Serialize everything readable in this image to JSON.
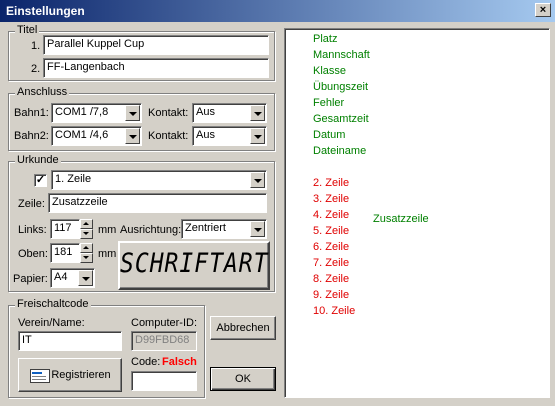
{
  "window": {
    "title": "Einstellungen",
    "close_glyph": "×"
  },
  "titel": {
    "legend": "Titel",
    "row1_label": "1.",
    "row1_value": "Parallel Kuppel Cup",
    "row2_label": "2.",
    "row2_value": "FF-Langenbach"
  },
  "anschluss": {
    "legend": "Anschluss",
    "bahn1_label": "Bahn1:",
    "bahn1_value": "COM1 /7,8",
    "kontakt1_label": "Kontakt:",
    "kontakt1_value": "Aus",
    "bahn2_label": "Bahn2:",
    "bahn2_value": "COM1 /4,6",
    "kontakt2_label": "Kontakt:",
    "kontakt2_value": "Aus"
  },
  "urkunde": {
    "legend": "Urkunde",
    "checkbox_mark": "✓",
    "zeile_select": "1. Zeile",
    "zeile_label": "Zeile:",
    "zeile_value": "Zusatzzeile",
    "links_label": "Links:",
    "links_value": "117",
    "links_unit": "mm",
    "ausrichtung_label": "Ausrichtung:",
    "ausrichtung_value": "Zentriert",
    "oben_label": "Oben:",
    "oben_value": "181",
    "oben_unit": "mm",
    "papier_label": "Papier:",
    "papier_value": "A4",
    "font_button": "SCHRIFTART"
  },
  "freischaltcode": {
    "legend": "Freischaltcode",
    "verein_label": "Verein/Name:",
    "verein_value": "IT",
    "computer_id_label": "Computer-ID:",
    "computer_id_value": "D99FBD68",
    "register_button": "Registrieren",
    "code_label": "Code:",
    "code_status": "Falsch",
    "code_value": ""
  },
  "buttons": {
    "cancel": "Abbrechen",
    "ok": "OK"
  },
  "preview": {
    "fields": [
      "Platz",
      "Mannschaft",
      "Klasse",
      "Übungszeit",
      "Fehler",
      "Gesamtzeit",
      "Datum",
      "Dateiname"
    ],
    "lines": [
      "2. Zeile",
      "3. Zeile",
      "4. Zeile",
      "5. Zeile",
      "6. Zeile",
      "7. Zeile",
      "8. Zeile",
      "9. Zeile",
      "10. Zeile"
    ],
    "zusatz": "Zusatzzeile"
  },
  "colors": {
    "field": "#008000",
    "line": "#e00000",
    "status_bad": "#ff0000"
  }
}
